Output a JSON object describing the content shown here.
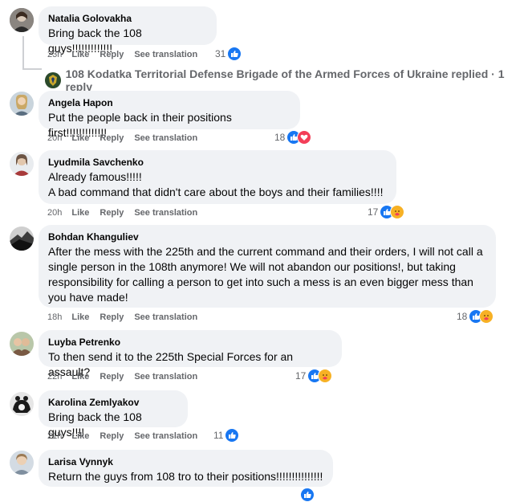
{
  "actions": {
    "like": "Like",
    "reply": "Reply",
    "see_translation": "See translation"
  },
  "replies_row": {
    "text": "108 Kodatka Territorial Defense Brigade of the Armed Forces of Ukraine replied · 1 reply"
  },
  "comments": [
    {
      "author": "Natalia Golovakha",
      "lines": [
        "Bring back the 108 guys!!!!!!!!!!!!!"
      ],
      "time": "23h",
      "reaction_count": "31",
      "reactions": [
        "like"
      ]
    },
    {
      "author": "Angela Hapon",
      "lines": [
        "Put the people back in their positions first!!!!!!!!!!!!!"
      ],
      "time": "20h",
      "reaction_count": "18",
      "reactions": [
        "like",
        "love"
      ]
    },
    {
      "author": "Lyudmila Savchenko",
      "lines": [
        "Already famous!!!!!",
        "A bad command that didn't care about the boys and their families!!!!"
      ],
      "time": "20h",
      "reaction_count": "17",
      "reactions": [
        "like",
        "care"
      ]
    },
    {
      "author": "Bohdan Khanguliev",
      "lines": [
        "After the mess with the 225th and the current command and their orders, I will not call a",
        "single person in the 108th anymore! We will not abandon our positions!, but taking",
        "responsibility for calling a person to get into such a mess is an even bigger mess than",
        "you have made!"
      ],
      "time": "18h",
      "reaction_count": "18",
      "reactions": [
        "like",
        "care"
      ]
    },
    {
      "author": "Luyba Petrenko",
      "lines": [
        "To then send it to the 225th Special Forces for an assault?"
      ],
      "time": "22h",
      "reaction_count": "17",
      "reactions": [
        "like",
        "care"
      ]
    },
    {
      "author": "Karolina Zemlyakov",
      "lines": [
        "Bring back the 108 guys!!!!"
      ],
      "time": "21h",
      "reaction_count": "11",
      "reactions": [
        "like"
      ]
    },
    {
      "author": "Larisa Vynnyk",
      "lines": [
        "Return the guys from 108 tro to their positions!!!!!!!!!!!!!!!"
      ],
      "time": "",
      "reaction_count": "",
      "reactions": []
    }
  ],
  "colors": {
    "bubble": "#f0f2f5",
    "meta_text": "#65676b",
    "like_blue": "#1877f2",
    "love_red": "#f33e58",
    "care_yellow": "#f7b125"
  }
}
